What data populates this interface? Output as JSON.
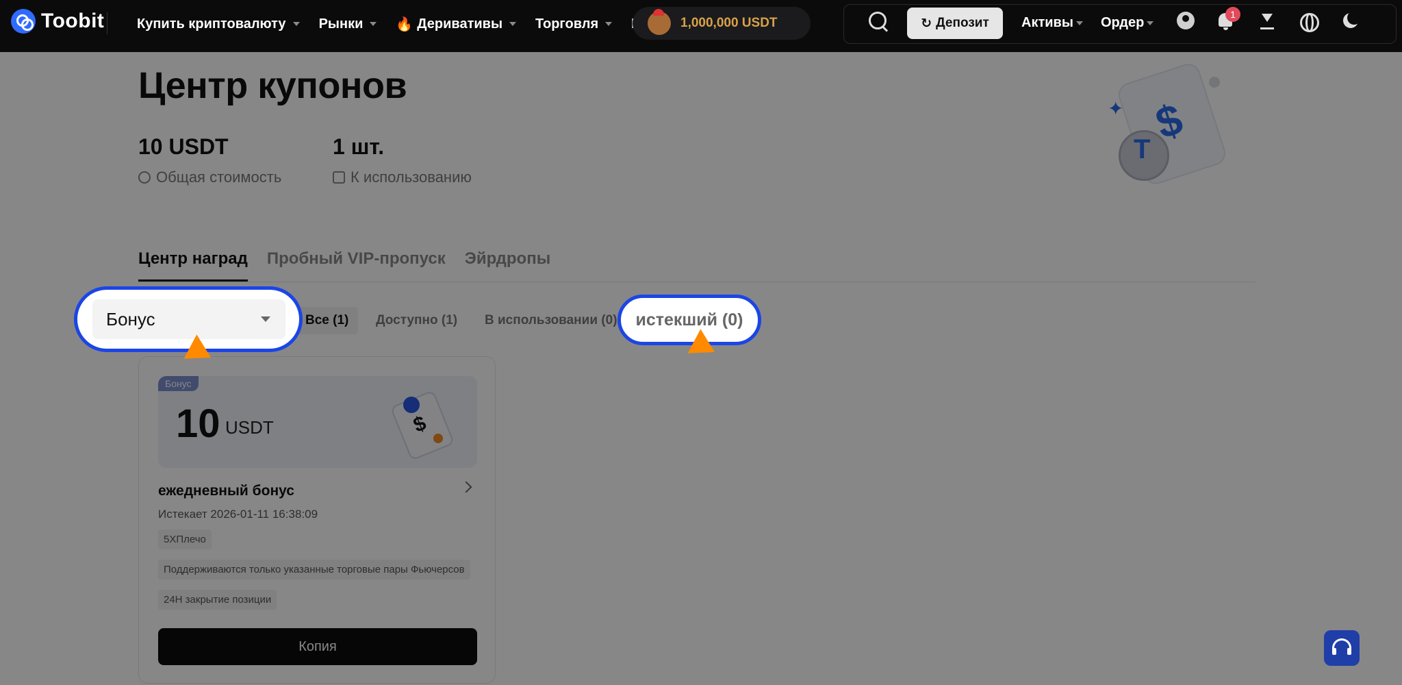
{
  "app": {
    "name": "Toobit"
  },
  "nav": {
    "items": [
      {
        "label": "Купить криптовалюту"
      },
      {
        "label": "Рынки"
      },
      {
        "label": "Деривативы"
      },
      {
        "label": "Торговля"
      },
      {
        "label": "К"
      }
    ],
    "promo": "1,000,000 USDT"
  },
  "right_nav": {
    "deposit": "Депозит",
    "assets": "Активы",
    "orders": "Ордер",
    "notification_count": "1"
  },
  "page": {
    "title": "Центр купонов",
    "stats": [
      {
        "value": "10 USDT",
        "label": "Общая стоимость"
      },
      {
        "value": "1 шт.",
        "label": "К использованию"
      }
    ]
  },
  "tabs": [
    "Центр наград",
    "Пробный VIP-пропуск",
    "Эйрдропы"
  ],
  "filter": {
    "select_value": "Бонус",
    "tabs": [
      "Все (1)",
      "Доступно (1)",
      "В использовании (0)",
      "истекший (0)"
    ]
  },
  "coupon": {
    "tag": "Бонус",
    "amount": "10",
    "unit": "USDT",
    "title": "ежедневный бонус",
    "expires": "Истекает 2026-01-11 16:38:09",
    "conditions": [
      "5XПлечо",
      "Поддерживаются только указанные торговые пары Фьючерсов",
      "24H закрытие позиции"
    ],
    "button": "Копия"
  },
  "colors": {
    "accent": "#2b6be8",
    "highlight": "#1b45e6",
    "cursor": "#ff8a00",
    "promo": "#d9a24a"
  }
}
